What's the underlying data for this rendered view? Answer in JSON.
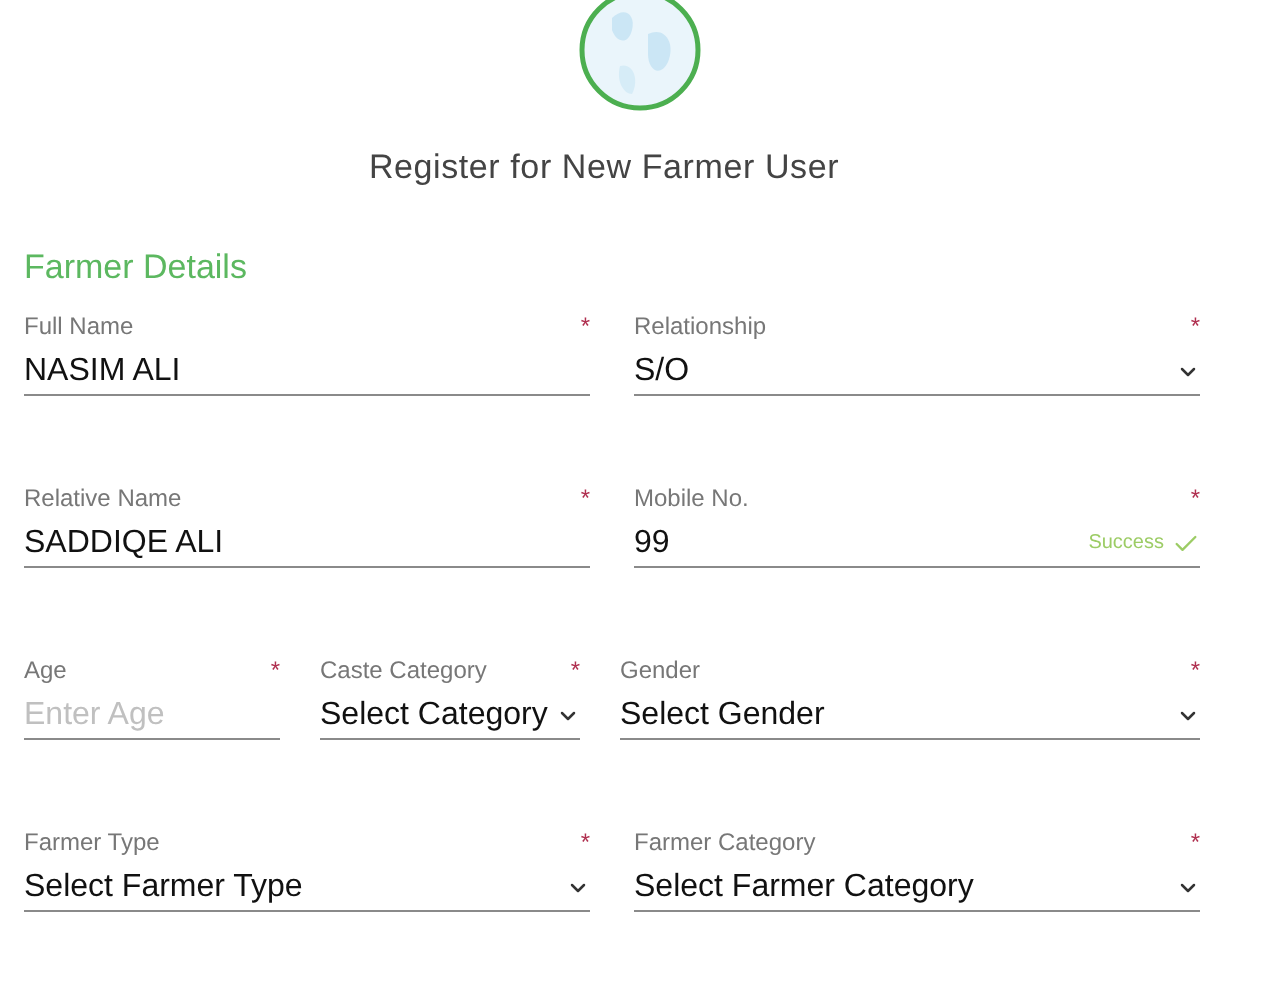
{
  "title": "Register for New Farmer User",
  "section": {
    "title": "Farmer Details"
  },
  "rows": [
    {
      "fields": [
        {
          "kind": "text",
          "label": "Full Name",
          "required_mark": "*",
          "value": "NASIM ALI"
        },
        {
          "kind": "select",
          "label": "Relationship",
          "required_mark": "*",
          "value": "S/O"
        }
      ]
    },
    {
      "fields": [
        {
          "kind": "text",
          "label": "Relative Name",
          "required_mark": "*",
          "value": "SADDIQE ALI"
        },
        {
          "kind": "verified",
          "label": "Mobile No.",
          "required_mark": "*",
          "value": "99",
          "status": "Success"
        }
      ]
    },
    {
      "fields": [
        {
          "kind": "text",
          "label": "Age",
          "required_mark": "*",
          "placeholder": "Enter Age"
        },
        {
          "kind": "select",
          "label": "Caste Category",
          "required_mark": "*",
          "value": "Select Category"
        },
        {
          "kind": "select",
          "label": "Gender",
          "required_mark": "*",
          "value": "Select Gender"
        }
      ]
    },
    {
      "fields": [
        {
          "kind": "select",
          "label": "Farmer Type",
          "required_mark": "*",
          "value": "Select Farmer Type"
        },
        {
          "kind": "select",
          "label": "Farmer Category",
          "required_mark": "*",
          "value": "Select Farmer Category"
        }
      ]
    }
  ]
}
